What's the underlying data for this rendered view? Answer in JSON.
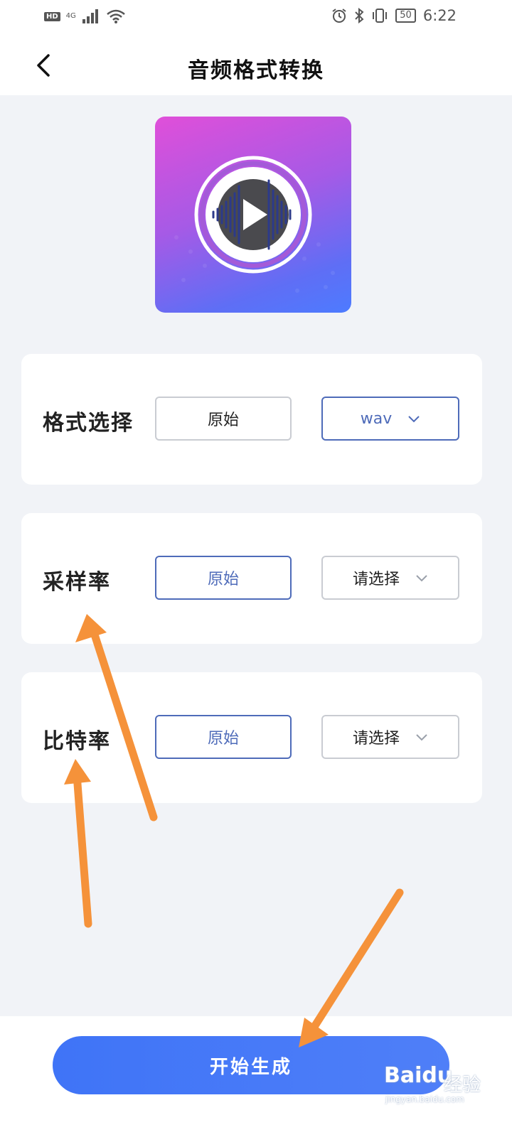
{
  "status_bar": {
    "hd": "HD",
    "network": "4G",
    "battery": "50",
    "time": "6:22"
  },
  "header": {
    "title": "音频格式转换"
  },
  "rows": [
    {
      "label": "格式选择",
      "original": "原始",
      "select_value": "wav",
      "original_active": false,
      "select_active": true
    },
    {
      "label": "采样率",
      "original": "原始",
      "select_value": "请选择",
      "original_active": true,
      "select_active": false
    },
    {
      "label": "比特率",
      "original": "原始",
      "select_value": "请选择",
      "original_active": true,
      "select_active": false
    }
  ],
  "start_button": "开始生成",
  "watermark": {
    "brand": "Baidu",
    "suffix": "经验",
    "url": "jingyan.baidu.com"
  },
  "colors": {
    "accent": "#4e6bb9",
    "button_blue": "#4577f7",
    "annotation_arrow": "#f5923a"
  },
  "icons": [
    "back-arrow-icon",
    "chevron-down-icon",
    "play-icon",
    "alarm-icon",
    "bluetooth-icon",
    "vibrate-icon",
    "wifi-icon",
    "signal-icon"
  ]
}
